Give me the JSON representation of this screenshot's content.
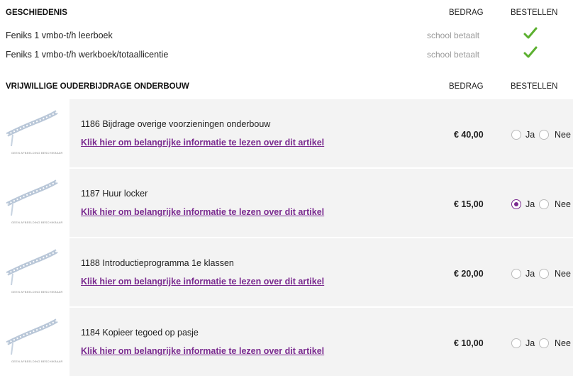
{
  "section1": {
    "title": "GESCHIEDENIS",
    "col_amount": "BEDRAG",
    "col_order": "BESTELLEN",
    "items": [
      {
        "name": "Feniks 1 vmbo-t/h leerboek",
        "status": "school betaalt",
        "ordered_icon": "checkmark-icon"
      },
      {
        "name": "Feniks 1 vmbo-t/h werkboek/totaallicentie",
        "status": "school betaalt",
        "ordered_icon": "checkmark-icon"
      }
    ]
  },
  "section2": {
    "title": "VRIJWILLIGE OUDERBIJDRAGE ONDERBOUW",
    "col_amount": "BEDRAG",
    "col_order": "BESTELLEN",
    "image_placeholder": "GEEN AFBEELDING BESCHIKBAAR",
    "info_link": "Klik hier om belangrijke informatie te lezen over dit artikel",
    "yes_label": "Ja",
    "no_label": "Nee",
    "items": [
      {
        "title": "1186  Bijdrage overige voorzieningen onderbouw",
        "price": "€ 40,00",
        "selected": "none"
      },
      {
        "title": "1187  Huur locker",
        "price": "€ 15,00",
        "selected": "ja"
      },
      {
        "title": "1188  Introductieprogramma 1e klassen",
        "price": "€ 20,00",
        "selected": "none"
      },
      {
        "title": "1184  Kopieer tegoed op pasje",
        "price": "€ 10,00",
        "selected": "none"
      }
    ]
  },
  "colors": {
    "accent": "#7a2a8f",
    "check": "#5cb030",
    "row_bg": "#f3f3f3"
  }
}
